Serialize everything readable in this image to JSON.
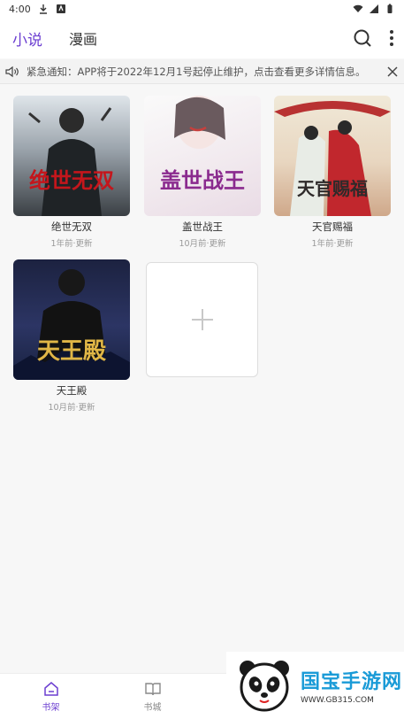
{
  "status_bar": {
    "time": "4:00"
  },
  "header": {
    "tabs": [
      {
        "label": "小说"
      },
      {
        "label": "漫画"
      }
    ]
  },
  "notice": {
    "text": "紧急通知：APP将于2022年12月1号起停止维护，点击查看更多详情信息。"
  },
  "shelf": {
    "books": [
      {
        "title": "绝世无双",
        "cover_text": "绝世无双",
        "updated": "1年前·更新"
      },
      {
        "title": "盖世战王",
        "cover_text": "盖世战王",
        "updated": "10月前·更新"
      },
      {
        "title": "天官赐福",
        "cover_text": "天官赐福",
        "updated": "1年前·更新"
      },
      {
        "title": "天王殿",
        "cover_text": "天王殿",
        "updated": "10月前·更新"
      }
    ]
  },
  "bottom_nav": {
    "items": [
      {
        "label": "书架"
      },
      {
        "label": "书城"
      }
    ]
  },
  "watermark": {
    "title": "国宝手游网",
    "url": "WWW.GB315.COM"
  },
  "colors": {
    "accent": "#6c3fd1",
    "brand": "#1a9bd7"
  }
}
